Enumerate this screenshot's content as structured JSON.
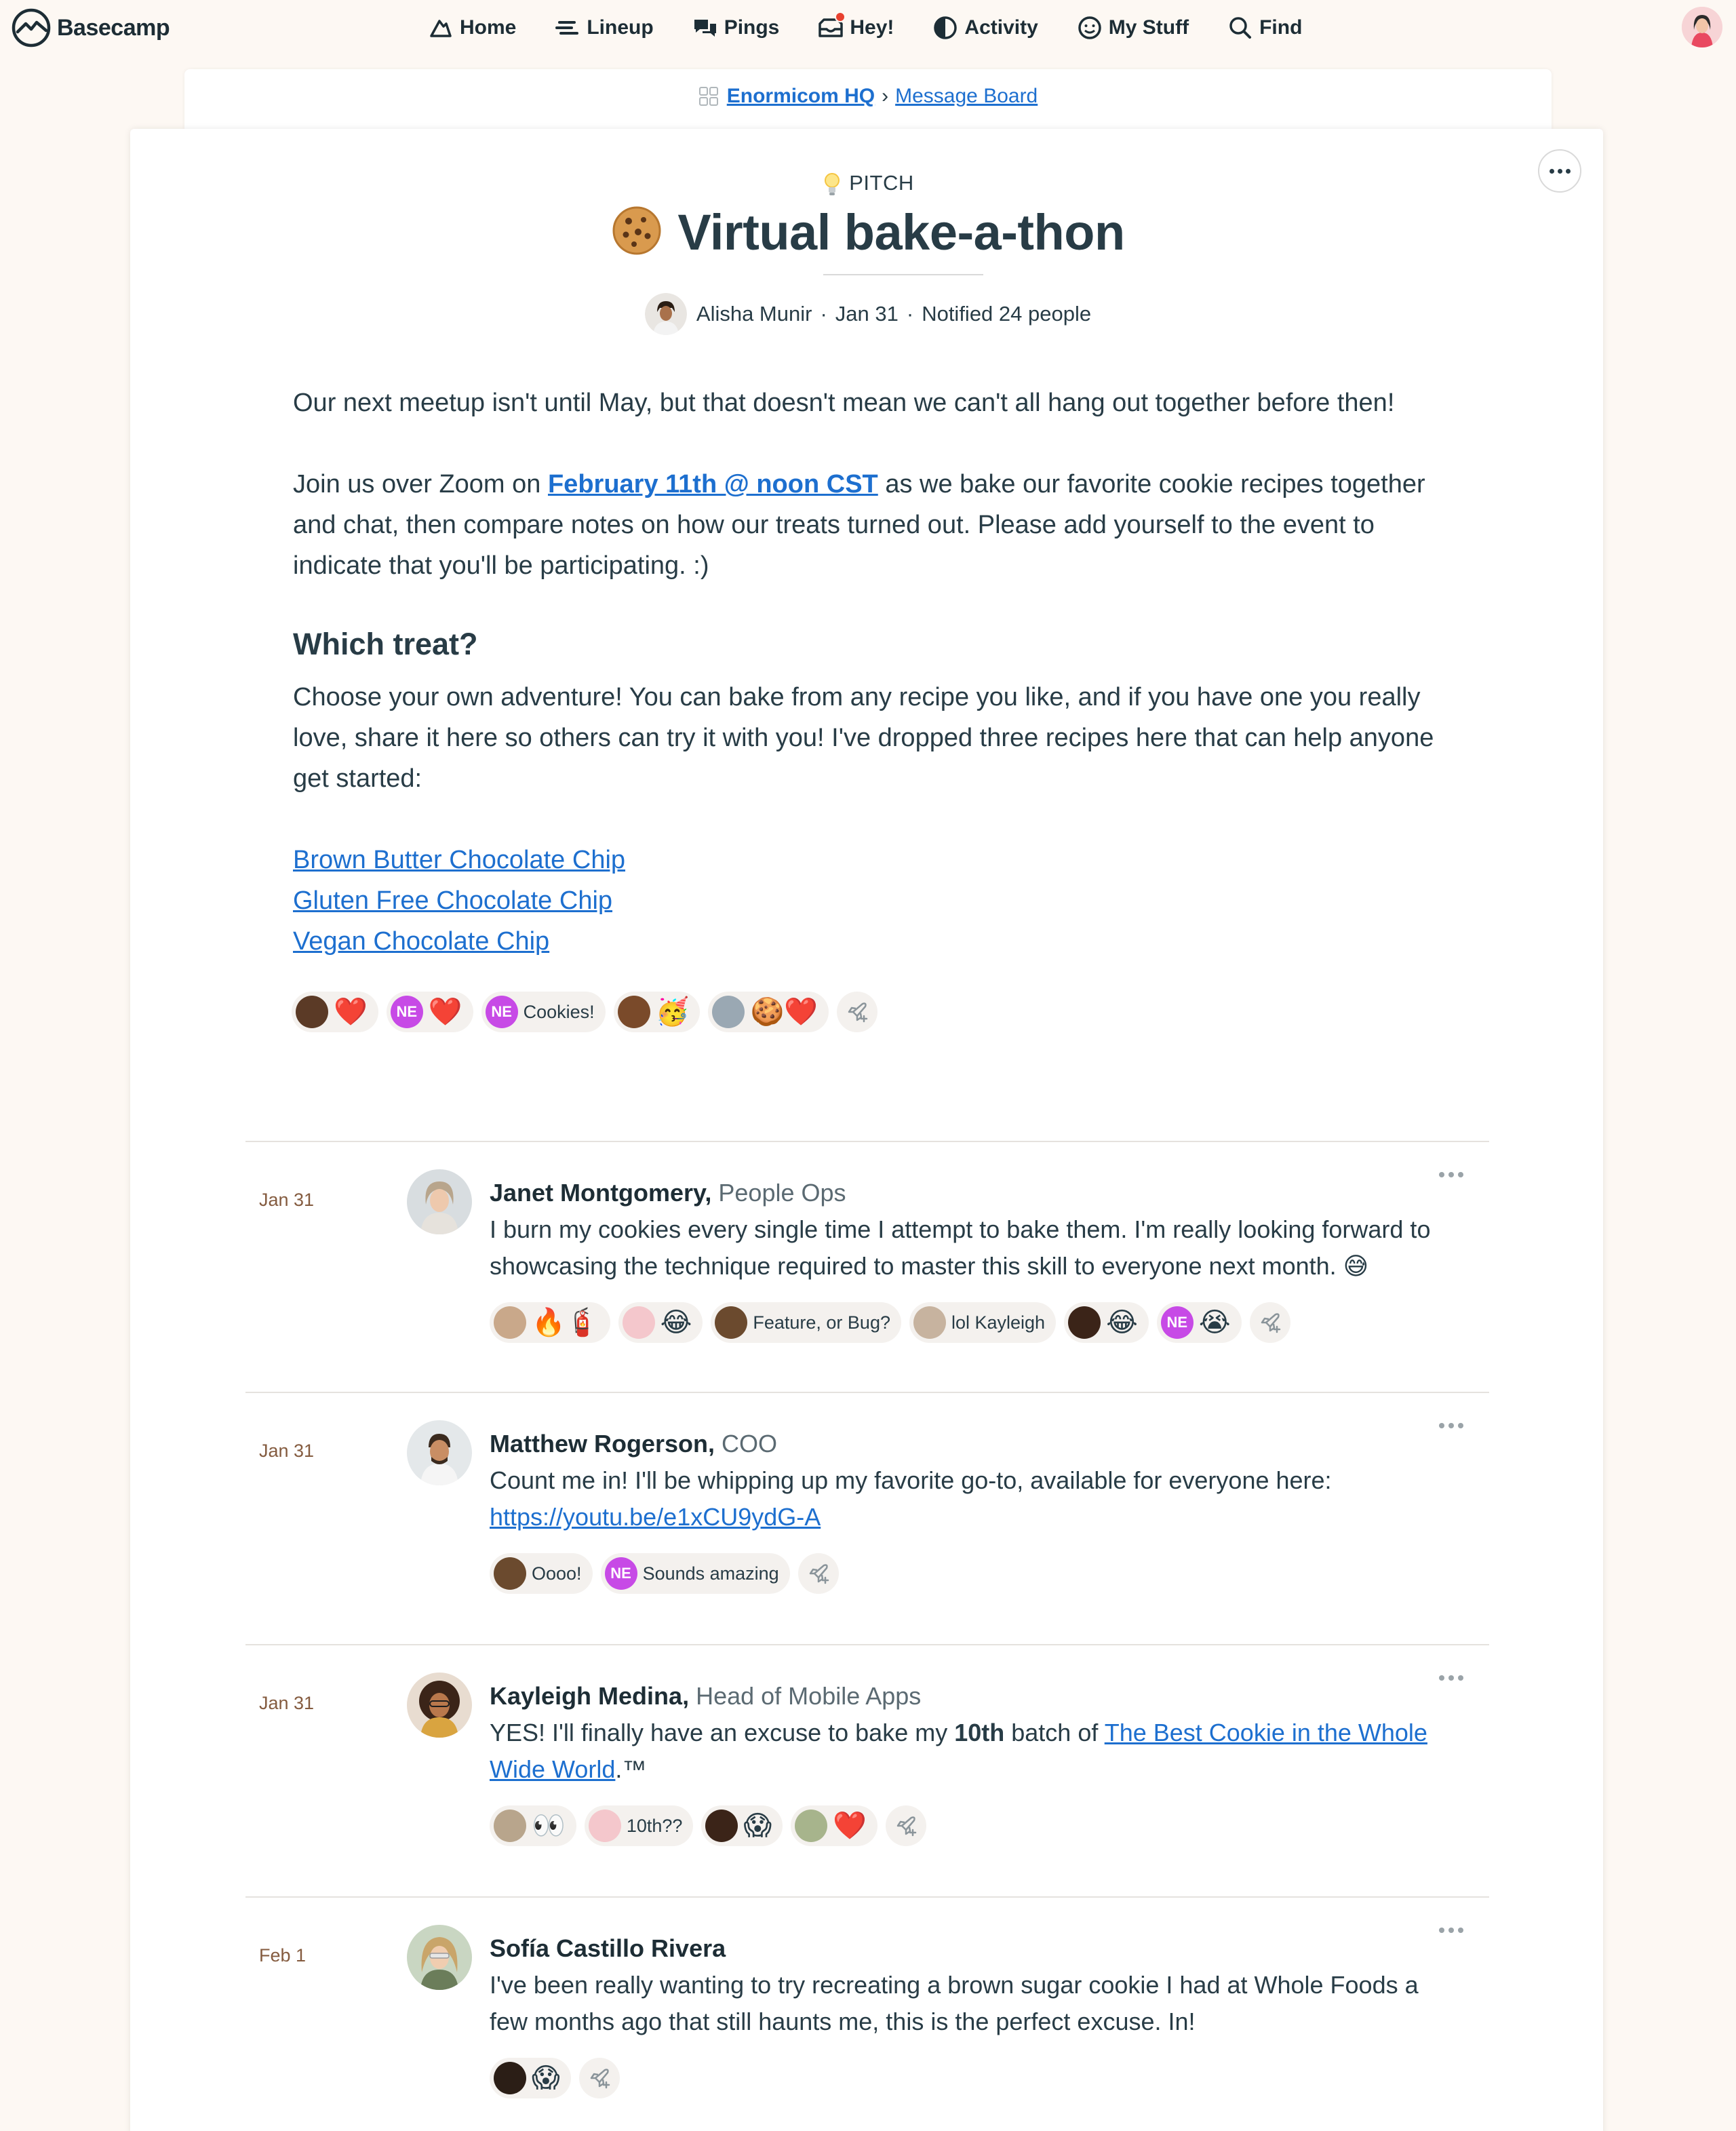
{
  "brand": {
    "name": "Basecamp"
  },
  "nav": {
    "items": [
      {
        "label": "Home",
        "icon": "home-icon"
      },
      {
        "label": "Lineup",
        "icon": "lineup-icon"
      },
      {
        "label": "Pings",
        "icon": "pings-icon"
      },
      {
        "label": "Hey!",
        "icon": "hey-icon",
        "notification": true
      },
      {
        "label": "Activity",
        "icon": "activity-icon"
      },
      {
        "label": "My Stuff",
        "icon": "my-stuff-icon"
      },
      {
        "label": "Find",
        "icon": "search-icon"
      }
    ]
  },
  "breadcrumb": {
    "project": "Enormicom HQ",
    "separator": "›",
    "board": "Message Board"
  },
  "message": {
    "category": "PITCH",
    "title": "Virtual bake-a-thon",
    "author": "Alisha Munir",
    "date": "Jan 31",
    "notified": "Notified 24 people",
    "dot": "·",
    "p1": "Our next meetup isn't until May, but that doesn't mean we can't all hang out together before then!",
    "p2_before": "Join us over Zoom on ",
    "p2_link": "February 11th @ noon CST",
    "p2_after": " as we bake our favorite cookie recipes together and chat, then compare notes on how our treats turned out. Please add yourself to the event to indicate that you'll be participating. :)",
    "heading": "Which treat?",
    "p3": "Choose your own adventure! You can bake from any recipe you like, and if you have one you really love, share it here so others can try it with you! I've dropped three recipes here that can help anyone get started:",
    "links": [
      "Brown Butter Chocolate Chip",
      "Gluten Free Chocolate Chip",
      "Vegan Chocolate Chip"
    ],
    "boosts": [
      {
        "content": "❤️"
      },
      {
        "initials": "NE",
        "content": "❤️"
      },
      {
        "initials": "NE",
        "content": "Cookies!"
      },
      {
        "content": "🥳"
      },
      {
        "content": "🍪❤️"
      }
    ]
  },
  "comments": [
    {
      "date": "Jan 31",
      "name": "Janet Montgomery,",
      "role": "People Ops",
      "text": "I burn my cookies every single time I attempt to bake them. I'm really looking forward to showcasing the technique required to master this skill to everyone next month. 😅",
      "boosts": [
        "🔥🧯",
        "😂",
        "Feature, or Bug?",
        "lol Kayleigh",
        "😂",
        "😭"
      ],
      "boost_ne": [
        false,
        false,
        false,
        false,
        false,
        true
      ]
    },
    {
      "date": "Jan 31",
      "name": "Matthew Rogerson,",
      "role": "COO",
      "text_before": "Count me in! I'll be whipping up my favorite go-to, available for everyone here: ",
      "link": "https://youtu.be/e1xCU9ydG-A",
      "boosts": [
        "Oooo!",
        "Sounds amazing"
      ],
      "boost_ne": [
        false,
        true
      ]
    },
    {
      "date": "Jan 31",
      "name": "Kayleigh Medina,",
      "role": "Head of Mobile Apps",
      "text_before": "YES! I'll finally have an excuse to bake my ",
      "bold": "10th",
      "text_mid": " batch of ",
      "link": "The Best Cookie in the Whole Wide World",
      "text_after": ".™",
      "boosts": [
        "👀",
        "10th??",
        "😱",
        "❤️"
      ]
    },
    {
      "date": "Feb 1",
      "name": "Sofía Castillo Rivera",
      "role": "",
      "text": "I've been really wanting to try recreating a brown sugar cookie I had at Whole Foods a few months ago that still haunts me, this is the perfect excuse. In!",
      "boosts": [
        "😱"
      ]
    }
  ],
  "colors": {
    "link": "#1d6fcf",
    "ne_badge": "#c74ae6",
    "date": "#845b3f",
    "text": "#283c46",
    "page_bg": "#fdf8f3"
  }
}
